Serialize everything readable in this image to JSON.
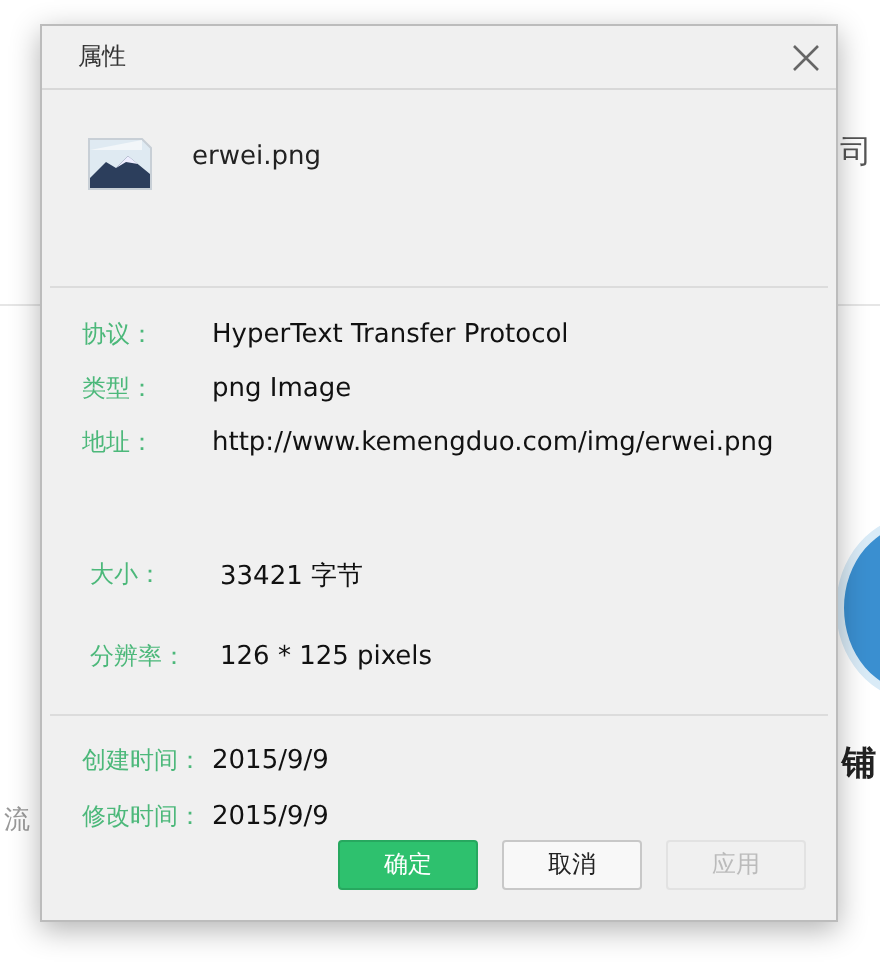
{
  "background": {
    "texts": [
      {
        "text": "司",
        "kind": "right-top"
      },
      {
        "text": "铺",
        "kind": "right-heading"
      },
      {
        "text": "流",
        "kind": "left-body"
      }
    ]
  },
  "dialog": {
    "title": "属性",
    "file": {
      "name": "erwei.png"
    },
    "sections": [
      {
        "rows": [
          {
            "label": "协议：",
            "value": "HyperText Transfer Protocol"
          },
          {
            "label": "类型：",
            "value": "png Image"
          },
          {
            "label": "地址：",
            "value": "http://www.kemengduo.com/img/erwei.png"
          }
        ]
      },
      {
        "rows": [
          {
            "label": "大小：",
            "value": "33421 字节"
          },
          {
            "label": "分辨率：",
            "value": "126 * 125 pixels"
          }
        ]
      },
      {
        "rows": [
          {
            "label": "创建时间：",
            "value": "2015/9/9"
          },
          {
            "label": "修改时间：",
            "value": "2015/9/9"
          }
        ]
      }
    ],
    "buttons": [
      {
        "label": "确定",
        "kind": "primary",
        "disabled": false
      },
      {
        "label": "取消",
        "kind": "default",
        "disabled": false
      },
      {
        "label": "应用",
        "kind": "default",
        "disabled": true
      }
    ]
  }
}
